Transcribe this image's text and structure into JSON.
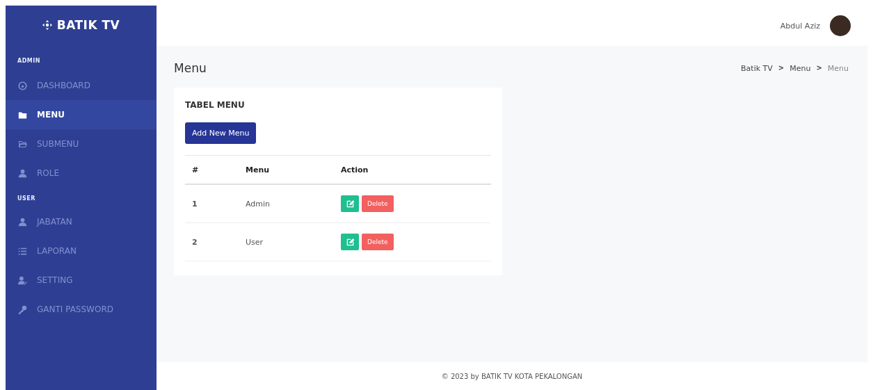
{
  "brand": {
    "title": "BATIK TV"
  },
  "sidebar": {
    "sections": [
      {
        "heading": "ADMIN",
        "items": [
          {
            "label": "DASHBOARD",
            "selected": false
          },
          {
            "label": "MENU",
            "selected": true
          },
          {
            "label": "SUBMENU",
            "selected": false
          },
          {
            "label": "ROLE",
            "selected": false
          }
        ]
      },
      {
        "heading": "USER",
        "items": [
          {
            "label": "JABATAN",
            "selected": false
          },
          {
            "label": "LAPORAN",
            "selected": false
          },
          {
            "label": "SETTING",
            "selected": false
          },
          {
            "label": "GANTI PASSWORD",
            "selected": false
          }
        ]
      }
    ]
  },
  "topbar": {
    "user_name": "Abdul Aziz"
  },
  "page": {
    "title": "Menu",
    "breadcrumb": [
      {
        "label": "Batik TV"
      },
      {
        "label": "Menu",
        "separator": ">"
      },
      {
        "label": "Menu",
        "separator": ">"
      }
    ]
  },
  "card": {
    "title": "TABEL MENU",
    "add_button": "Add New Menu",
    "table": {
      "columns": [
        "#",
        "Menu",
        "Action"
      ],
      "rows": [
        {
          "number": "1",
          "menu": "Admin",
          "delete": "Delete"
        },
        {
          "number": "2",
          "menu": "User",
          "delete": "Delete"
        }
      ]
    }
  },
  "footer": {
    "text": "© 2023 by BATIK TV KOTA PEKALONGAN"
  }
}
